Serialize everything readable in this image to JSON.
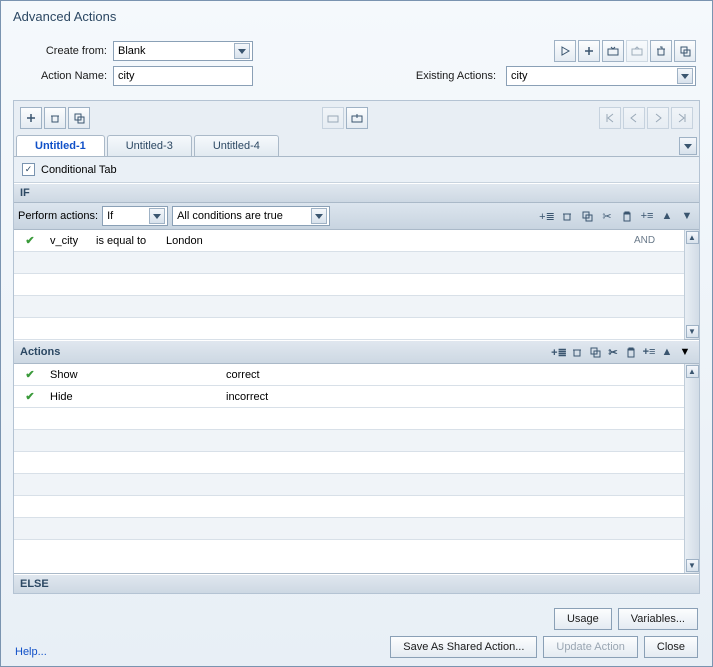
{
  "title": "Advanced Actions",
  "createFromLabel": "Create from:",
  "createFromValue": "Blank",
  "actionNameLabel": "Action Name:",
  "actionNameValue": "city",
  "existingActionsLabel": "Existing Actions:",
  "existingActionsValue": "city",
  "tabs": [
    "Untitled-1",
    "Untitled-3",
    "Untitled-4"
  ],
  "activeTab": 0,
  "conditionalTabLabel": "Conditional Tab",
  "conditionalChecked": true,
  "ifLabel": "IF",
  "elseLabel": "ELSE",
  "performLabel": "Perform actions:",
  "performValue": "If",
  "conditionsValue": "All conditions are true",
  "conditions": [
    {
      "var": "v_city",
      "op": "is equal to",
      "val": "London",
      "logic": "AND"
    }
  ],
  "actionsLabel": "Actions",
  "actions": [
    {
      "cmd": "Show",
      "target": "correct"
    },
    {
      "cmd": "Hide",
      "target": "incorrect"
    }
  ],
  "buttons": {
    "usage": "Usage",
    "variables": "Variables...",
    "saveShared": "Save As Shared Action...",
    "update": "Update Action",
    "close": "Close",
    "help": "Help..."
  }
}
